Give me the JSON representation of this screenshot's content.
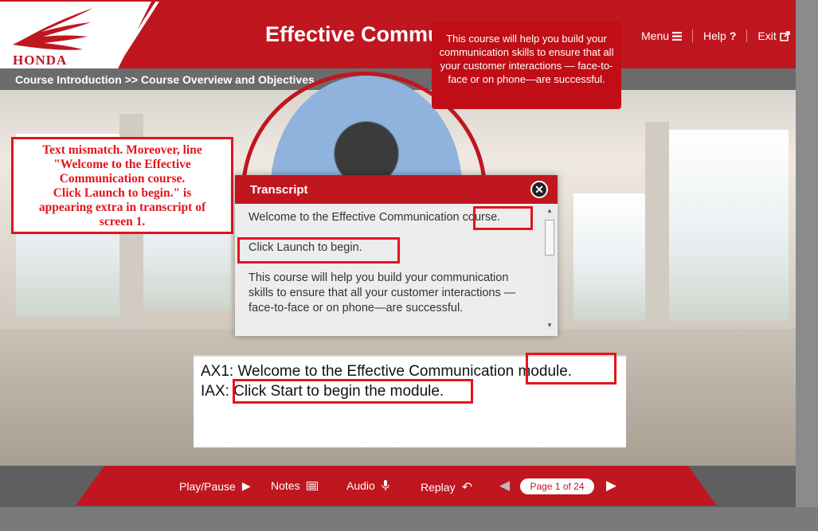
{
  "header": {
    "logo_text": "HONDA",
    "title": "Effective Communication",
    "nav": {
      "menu": "Menu",
      "help": "Help",
      "exit": "Exit"
    }
  },
  "breadcrumb": "Course Introduction >> Course Overview and Objectives",
  "speech_bubble": "This course will help you build your communication skills to ensure that all your customer interactions — face-to-face or on phone—are successful.",
  "review_note": {
    "lines": [
      "Text mismatch.      Moreover, line",
      "\"Welcome to the Effective",
      "Communication course.",
      "Click Launch to begin.\" is",
      "appearing extra in transcript of",
      "screen 1."
    ]
  },
  "transcript": {
    "title": "Transcript",
    "paragraphs": [
      "Welcome to the Effective Communication course.",
      "Click Launch to begin.",
      "This course will help you build your communication skills to ensure that all your customer interactions —face-to-face or on phone—are successful."
    ]
  },
  "captions": [
    "AX1: Welcome to the Effective Communication module.",
    "IAX: Click Start to begin the module."
  ],
  "footer": {
    "play_pause": "Play/Pause",
    "notes": "Notes",
    "audio": "Audio",
    "replay": "Replay",
    "page_indicator": "Page 1 of 24"
  },
  "colors": {
    "brand_red": "#c0161f",
    "annotation_red": "#e3141c"
  }
}
